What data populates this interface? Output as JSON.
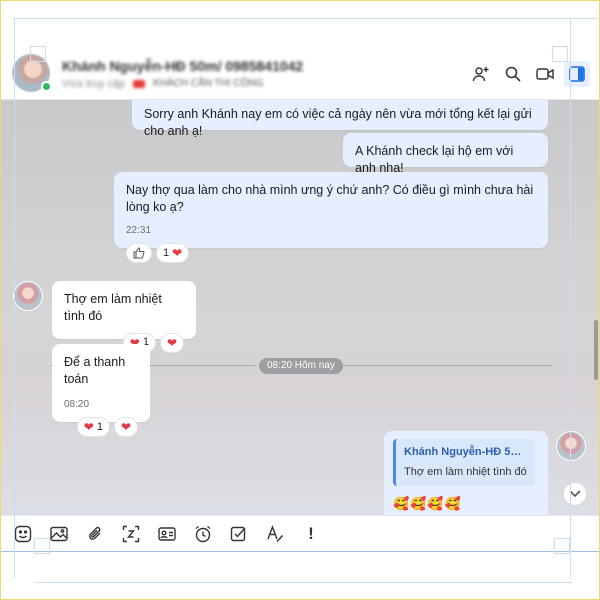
{
  "header": {
    "name": "Khánh Nguyễn-HĐ 50m/ 0985841042",
    "status": "Vừa truy cập",
    "tag_label": "KHÁCH CẦN THI CÔNG",
    "tag_color": "#e53935",
    "icons": [
      "add-member-icon",
      "search-icon",
      "video-call-icon",
      "sidebar-toggle-icon"
    ]
  },
  "messages": [
    {
      "side": "me",
      "text": "Sorry anh Khánh nay em có việc cả ngày nên vừa mới tổng kết lại gửi cho anh ạ!"
    },
    {
      "side": "me",
      "text": "A Khánh check lại hộ em với anh nha!"
    },
    {
      "side": "me",
      "text": "Nay thợ qua làm cho nhà mình ưng ý chứ anh? Có điều gì mình chưa hài lòng ko ạ?",
      "time": "22:31",
      "reaction_count": "1"
    },
    {
      "side": "them",
      "text": "Thợ em làm nhiệt tình đó",
      "reaction_count": "1"
    },
    {
      "side": "them",
      "text": "Để a thanh toán",
      "time": "08:20",
      "reaction_count": "1"
    }
  ],
  "divider": {
    "label": "08:20 Hôm nay"
  },
  "reply": {
    "quote_name": "Khánh Nguyễn-HĐ 50m...",
    "quote_text": "Thợ em làm nhiệt tình đó",
    "emojis": [
      "🥰",
      "🥰",
      "🥰",
      "🥰"
    ]
  },
  "toolbar": {
    "icons": [
      "sticker-icon",
      "image-icon",
      "attachment-icon",
      "screenshot-icon",
      "contact-card-icon",
      "reminder-clock-icon",
      "task-icon",
      "text-format-icon",
      "important-icon"
    ],
    "important_label": "!"
  },
  "colors": {
    "my_bubble": "#e6efff",
    "their_bubble": "#ffffff",
    "online": "#2dbd61",
    "heart": "#e53947",
    "accent": "#4d8ae6"
  }
}
